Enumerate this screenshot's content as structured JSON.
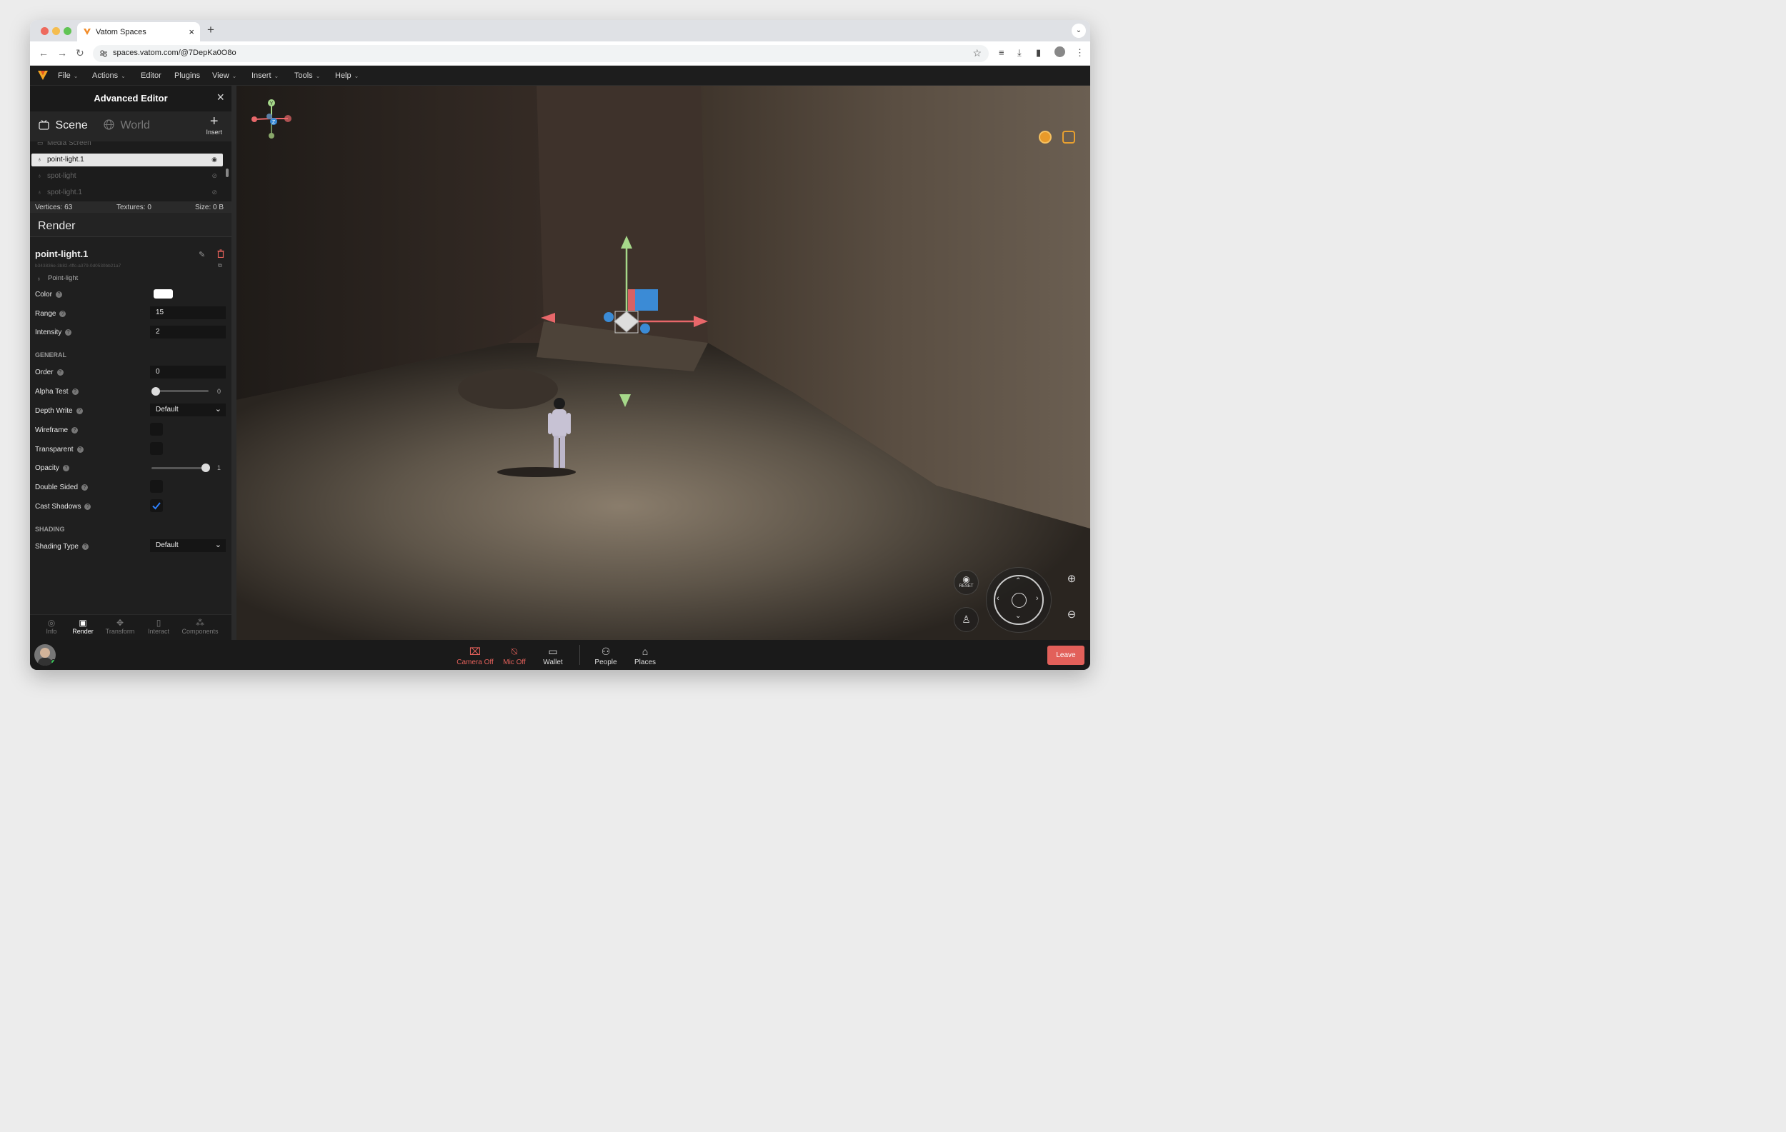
{
  "browser": {
    "tab_title": "Vatom Spaces",
    "new_tab": "+",
    "tab_menu": "⌄",
    "url": "spaces.vatom.com/@7DepKa0O8o"
  },
  "menu": [
    "File",
    "Actions",
    "Editor",
    "Plugins",
    "View",
    "Insert",
    "Tools",
    "Help"
  ],
  "menu_has_chevron": [
    true,
    true,
    false,
    false,
    true,
    true,
    true,
    true
  ],
  "panel": {
    "title": "Advanced Editor",
    "tabs": {
      "scene": "Scene",
      "world": "World",
      "insert": "Insert"
    },
    "tree": [
      "Media Screen",
      "point-light.1",
      "spot-light",
      "spot-light.1"
    ],
    "stats": {
      "vertices": "Vertices: 63",
      "textures": "Textures: 0",
      "size": "Size: 0 B"
    },
    "section": "Render",
    "entity": {
      "name": "point-light.1",
      "uuid": "b343836e-3b82-4ffc-a379-0d0530bb21a7",
      "type": "Point-light"
    },
    "props": {
      "color_label": "Color",
      "color_value": "#ffffff",
      "range_label": "Range",
      "range_value": "15",
      "intensity_label": "Intensity",
      "intensity_value": "2",
      "general_header": "GENERAL",
      "order_label": "Order",
      "order_value": "0",
      "alpha_label": "Alpha Test",
      "alpha_value": 0,
      "alpha_value_text": "0",
      "depth_label": "Depth Write",
      "depth_value": "Default",
      "wireframe_label": "Wireframe",
      "wireframe_checked": false,
      "transparent_label": "Transparent",
      "transparent_checked": false,
      "opacity_label": "Opacity",
      "opacity_value": 1,
      "opacity_value_text": "1",
      "double_label": "Double Sided",
      "double_checked": false,
      "cast_label": "Cast Shadows",
      "cast_checked": true,
      "shading_header": "SHADING",
      "shading_label": "Shading Type",
      "shading_value": "Default"
    },
    "bottom_tabs": [
      "Info",
      "Render",
      "Transform",
      "Interact",
      "Components"
    ],
    "active_bottom_tab": "Render"
  },
  "viewport": {
    "axis_y": "Y",
    "axis_z": "Z",
    "reset": "RESET"
  },
  "bottombar": {
    "camera": "Camera Off",
    "mic": "Mic Off",
    "wallet": "Wallet",
    "people": "People",
    "places": "Places",
    "leave": "Leave"
  },
  "colors": {
    "accent_red": "#e2605a",
    "axis_x": "#e8676a",
    "axis_y": "#a6d88a",
    "axis_z": "#3b8bd6",
    "checkbox_blue": "#2d7ff9"
  },
  "icons": [
    "vivaldi-logo-icon",
    "back-icon",
    "forward-icon",
    "reload-icon",
    "site-settings-icon",
    "star-icon",
    "media-icon",
    "download-icon",
    "sidebar-icon",
    "profile-icon",
    "more-icon",
    "close-icon",
    "scene-icon",
    "world-icon",
    "plus-icon",
    "eye-icon",
    "eye-off-icon",
    "lightbulb-icon",
    "pencil-icon",
    "trash-icon",
    "copy-icon",
    "help-icon",
    "chevron-down-icon",
    "check-icon",
    "camera-off-icon",
    "mic-off-icon",
    "wallet-icon",
    "people-icon",
    "places-icon",
    "zoom-in-icon",
    "zoom-out-icon",
    "joystick-icon",
    "reset-view-icon",
    "emote-icon",
    "coin-icon",
    "fullscreen-icon"
  ]
}
